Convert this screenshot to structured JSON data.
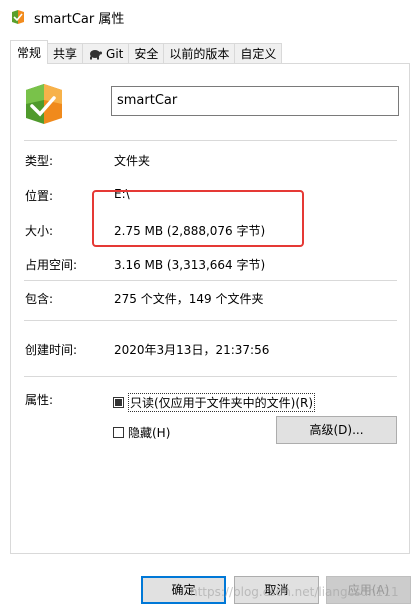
{
  "window": {
    "title": "smartCar 属性"
  },
  "tabs": [
    {
      "label": "常规",
      "active": true
    },
    {
      "label": "共享",
      "active": false
    },
    {
      "label": "Git",
      "active": false,
      "icon": "tortoise-git-icon"
    },
    {
      "label": "安全",
      "active": false
    },
    {
      "label": "以前的版本",
      "active": false
    },
    {
      "label": "自定义",
      "active": false
    }
  ],
  "general": {
    "folder_name": "smartCar",
    "rows": {
      "type": {
        "label": "类型:",
        "value": "文件夹"
      },
      "location": {
        "label": "位置:",
        "value": "E:\\"
      },
      "size": {
        "label": "大小:",
        "value": "2.75 MB (2,888,076 字节)"
      },
      "size_on_disk": {
        "label": "占用空间:",
        "value": "3.16 MB (3,313,664 字节)"
      },
      "contains": {
        "label": "包含:",
        "value": "275 个文件，149 个文件夹"
      },
      "created": {
        "label": "创建时间:",
        "value": "2020年3月13日，21:37:56"
      }
    },
    "attributes": {
      "label": "属性:",
      "readonly": {
        "label": "只读(仅应用于文件夹中的文件)(R)",
        "state": "indeterminate"
      },
      "hidden": {
        "label": "隐藏(H)",
        "checked": false
      },
      "advanced_button": "高级(D)..."
    }
  },
  "footer": {
    "ok": "确定",
    "cancel": "取消",
    "apply": "应用(A)"
  },
  "watermark": "https://blog.csdn.net/liangcsdn111",
  "colors": {
    "highlight_box": "#e53935",
    "primary_border": "#0078d7"
  }
}
